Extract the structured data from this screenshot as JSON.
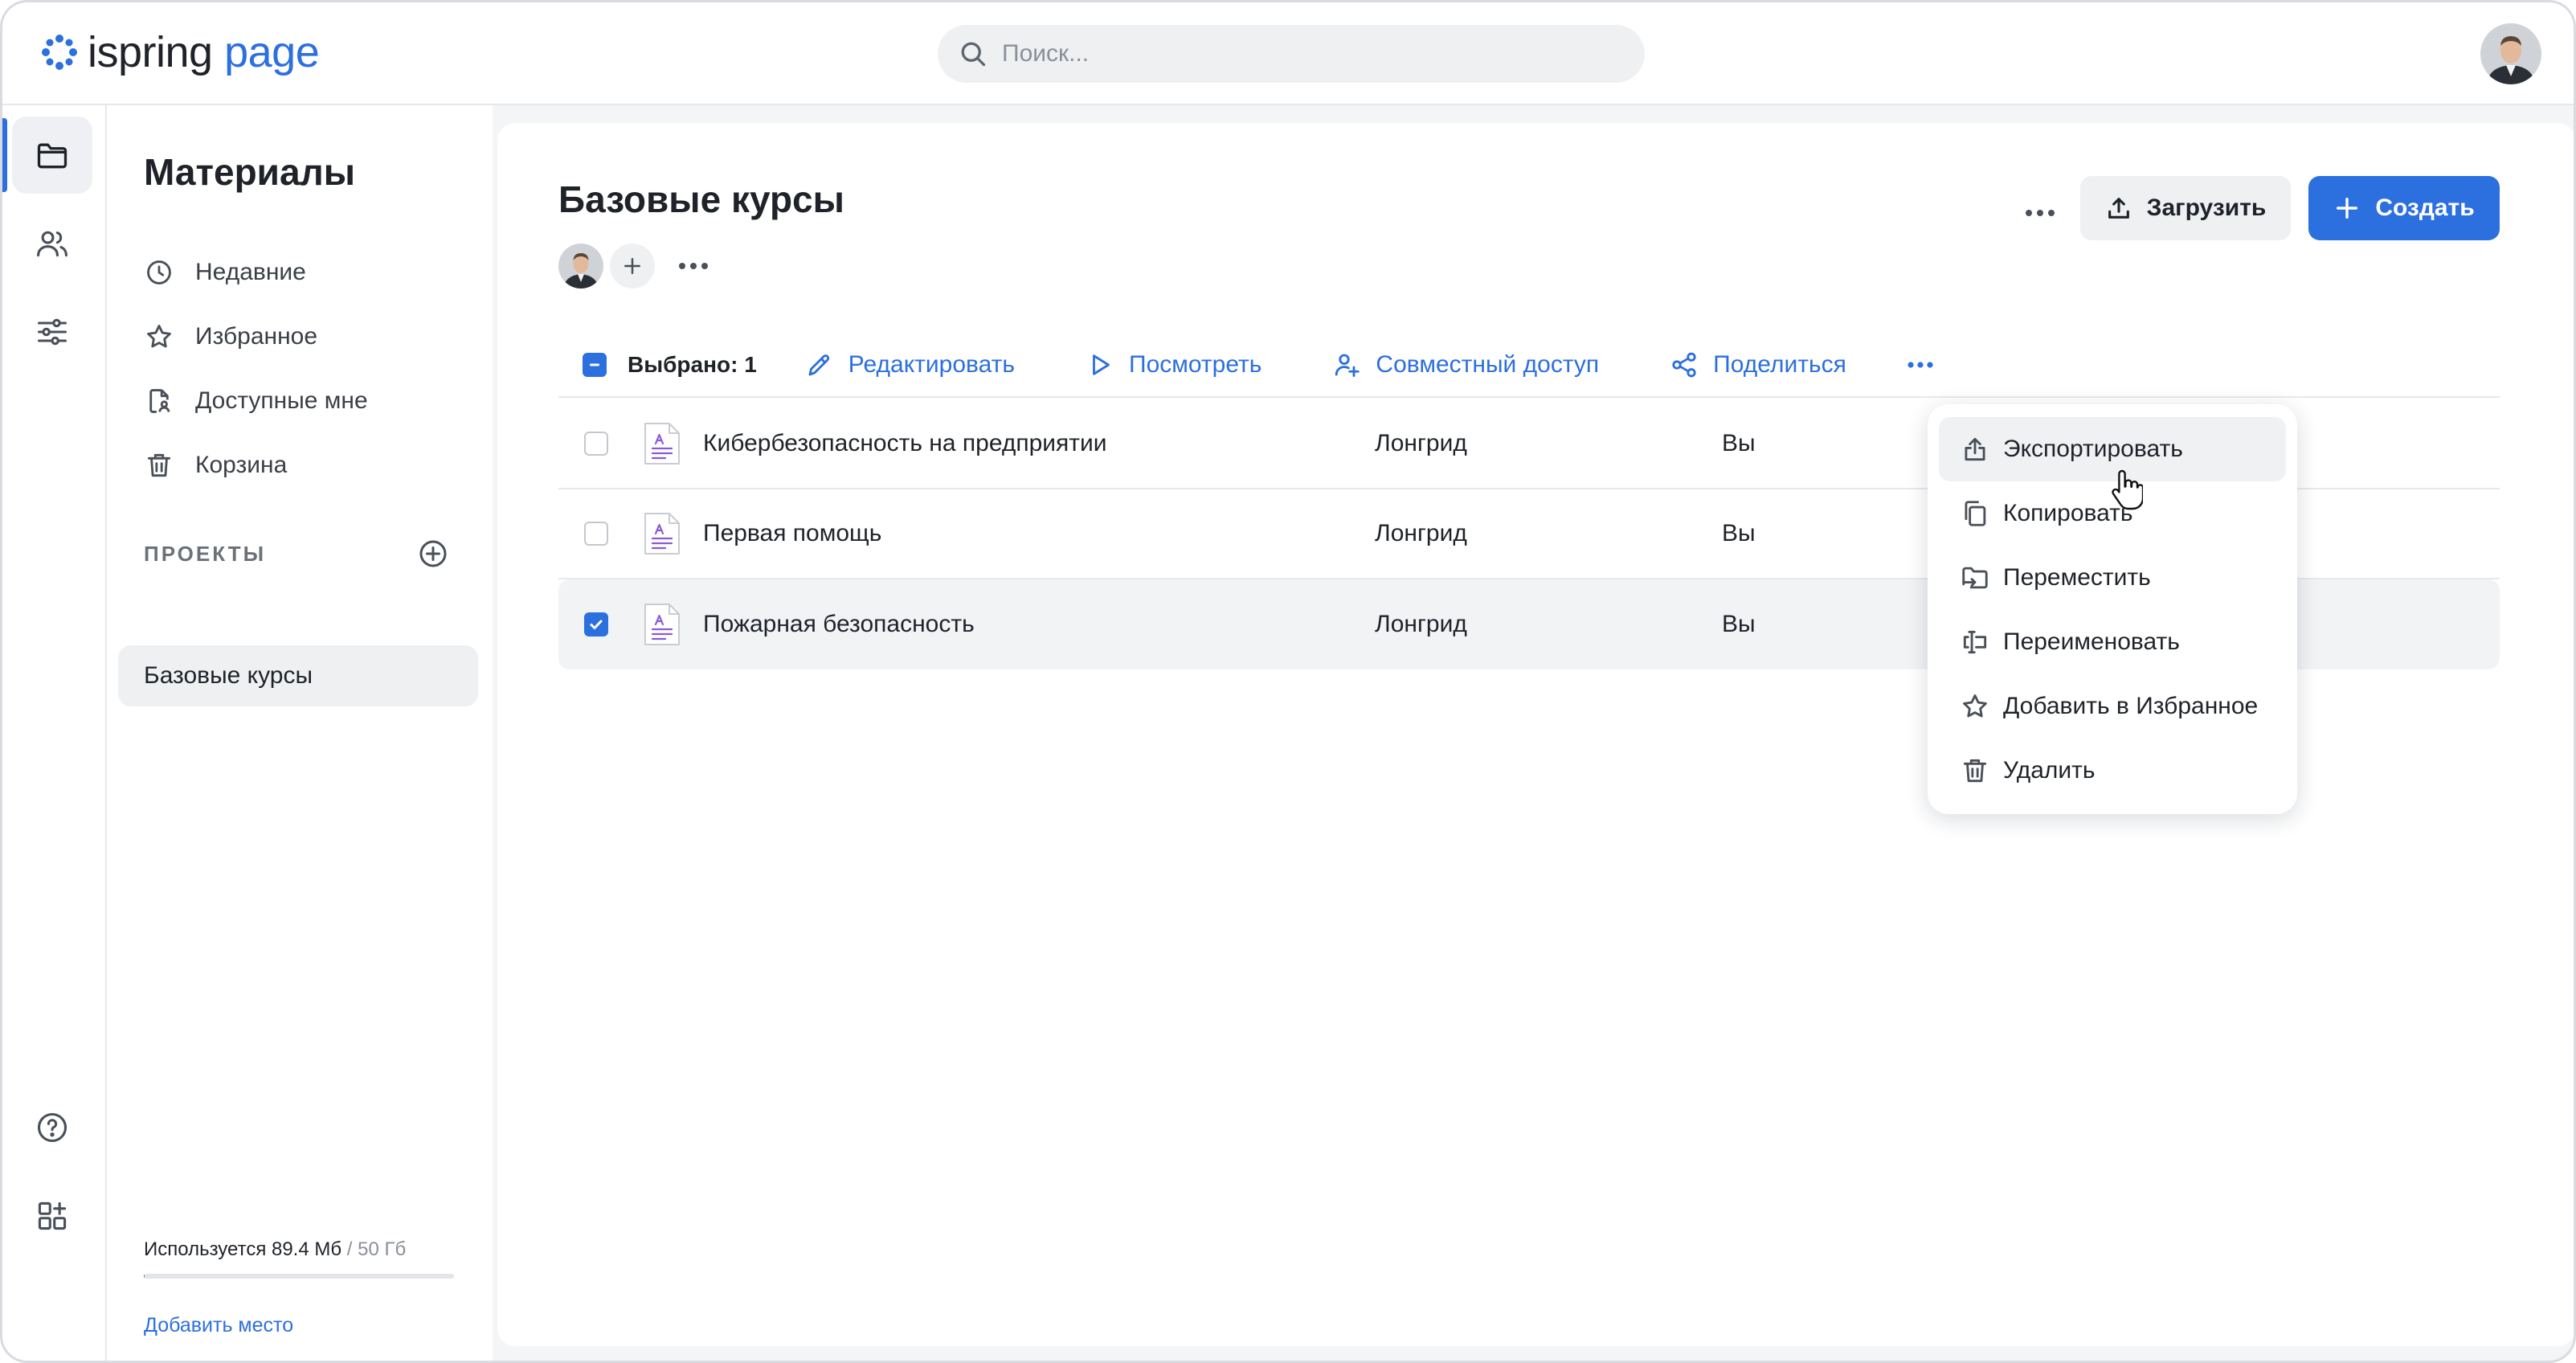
{
  "app": {
    "logo_part1": "ispring",
    "logo_part2": "page",
    "brand_color": "#2c6fdf"
  },
  "search": {
    "placeholder": "Поиск...",
    "value": ""
  },
  "rail": {
    "items": [
      {
        "name": "materials",
        "icon": "folder-icon",
        "active": true
      },
      {
        "name": "users",
        "icon": "users-icon",
        "active": false
      },
      {
        "name": "settings",
        "icon": "sliders-icon",
        "active": false
      },
      {
        "name": "help",
        "icon": "help-icon",
        "active": false
      },
      {
        "name": "apps",
        "icon": "apps-add-icon",
        "active": false
      }
    ]
  },
  "sidebar": {
    "title": "Материалы",
    "items": [
      {
        "label": "Недавние",
        "icon": "clock-icon"
      },
      {
        "label": "Избранное",
        "icon": "star-icon"
      },
      {
        "label": "Доступные мне",
        "icon": "shared-doc-icon"
      },
      {
        "label": "Корзина",
        "icon": "trash-icon"
      }
    ],
    "projects_label": "ПРОЕКТЫ",
    "projects": [
      {
        "label": "Базовые курсы",
        "active": true
      }
    ],
    "storage": {
      "used": "Используется 89.4 Мб",
      "total": "/ 50 Гб",
      "used_fraction": 0.0018,
      "add_link": "Добавить место"
    }
  },
  "main": {
    "title": "Базовые курсы",
    "upload_label": "Загрузить",
    "create_label": "Создать",
    "toolbar": {
      "selected": "Выбрано: 1",
      "actions": [
        {
          "label": "Редактировать",
          "icon": "pencil-icon"
        },
        {
          "label": "Посмотреть",
          "icon": "play-icon"
        },
        {
          "label": "Совместный доступ",
          "icon": "add-user-icon"
        },
        {
          "label": "Поделиться",
          "icon": "share-icon"
        }
      ]
    },
    "rows": [
      {
        "name": "Кибербезопасность на предприятии",
        "type": "Лонгрид",
        "owner": "Вы",
        "checked": false
      },
      {
        "name": "Первая помощь",
        "type": "Лонгрид",
        "owner": "Вы",
        "checked": false
      },
      {
        "name": "Пожарная безопасность",
        "type": "Лонгрид",
        "owner": "Вы",
        "checked": true
      }
    ]
  },
  "menu": {
    "items": [
      {
        "label": "Экспортировать",
        "icon": "export-icon",
        "hover": true
      },
      {
        "label": "Копировать",
        "icon": "copy-icon"
      },
      {
        "label": "Переместить",
        "icon": "move-folder-icon"
      },
      {
        "label": "Переименовать",
        "icon": "rename-icon"
      },
      {
        "label": "Добавить в Избранное",
        "icon": "star-icon"
      },
      {
        "label": "Удалить",
        "icon": "trash-icon"
      }
    ]
  }
}
